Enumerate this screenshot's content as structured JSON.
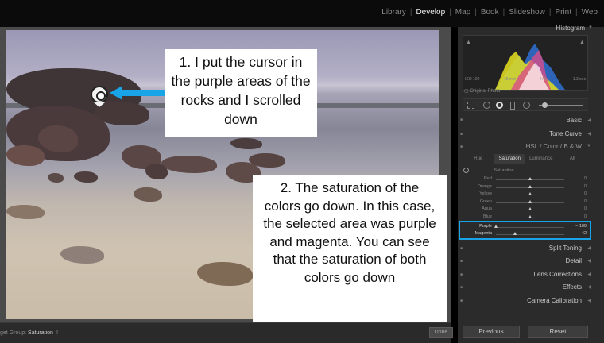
{
  "modules": [
    "Library",
    "Develop",
    "Map",
    "Book",
    "Slideshow",
    "Print",
    "Web"
  ],
  "active_module": "Develop",
  "bottombar": {
    "target_group_label": "get Group:",
    "target_group_value": "Saturation",
    "done_label": "Done"
  },
  "panels": {
    "histogram": "Histogram",
    "histogram_info": [
      "ISO 100",
      "18 mm",
      "f / 14",
      "1.3 sec"
    ],
    "original_photo": "Original Photo",
    "basic": "Basic",
    "tone_curve": "Tone Curve",
    "hsl_header": "HSL / Color / B & W",
    "hsl_tabs": [
      "Hue",
      "Saturation",
      "Luminance",
      "All"
    ],
    "saturation_label": "Saturation",
    "split_toning": "Split Toning",
    "detail": "Detail",
    "lens_corrections": "Lens Corrections",
    "effects": "Effects",
    "camera_calibration": "Camera Calibration"
  },
  "saturation_rows": [
    {
      "label": "Red",
      "value": "0",
      "level": 0
    },
    {
      "label": "Orange",
      "value": "0",
      "level": 0
    },
    {
      "label": "Yellow",
      "value": "0",
      "level": 0
    },
    {
      "label": "Green",
      "value": "0",
      "level": 0
    },
    {
      "label": "Aqua",
      "value": "0",
      "level": 0
    },
    {
      "label": "Blue",
      "value": "0",
      "level": 0
    },
    {
      "label": "Purple",
      "value": "− 100",
      "level": -100
    },
    {
      "label": "Magenta",
      "value": "− 42",
      "level": -42
    }
  ],
  "buttons": {
    "previous": "Previous",
    "reset": "Reset"
  },
  "callouts": {
    "first": "1. I put the cursor in the purple areas of the rocks and I scrolled down",
    "second": "2. The saturation of the colors go down. In this case, the selected area was purple and magenta. You can see that the saturation of both colors go down"
  },
  "colors": {
    "accent": "#19a4e8",
    "callout_bg": "#ffffff"
  }
}
